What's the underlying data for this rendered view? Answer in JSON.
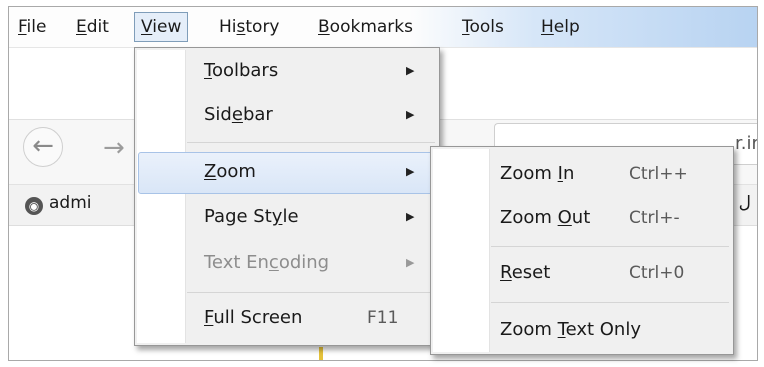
{
  "menubar": {
    "items": [
      {
        "pre": "",
        "acc": "F",
        "post": "ile"
      },
      {
        "pre": "",
        "acc": "E",
        "post": "dit"
      },
      {
        "pre": "",
        "acc": "V",
        "post": "iew"
      },
      {
        "pre": "Hi",
        "acc": "s",
        "post": "tory"
      },
      {
        "pre": "",
        "acc": "B",
        "post": "ookmarks"
      },
      {
        "pre": "",
        "acc": "T",
        "post": "ools"
      },
      {
        "pre": "",
        "acc": "H",
        "post": "elp"
      }
    ]
  },
  "browser": {
    "back_icon": "←",
    "forward_icon": "→",
    "url_fragment": "r.ir",
    "bookmark_label": "admi",
    "bookmark_icon": "globe-icon",
    "rtl_fragment": "ل"
  },
  "view_menu": {
    "items": [
      {
        "pre": "",
        "acc": "T",
        "post": "oolbars"
      },
      {
        "pre": "Sid",
        "acc": "e",
        "post": "bar"
      },
      {
        "pre": "",
        "acc": "Z",
        "post": "oom"
      },
      {
        "pre": "Page St",
        "acc": "y",
        "post": "le"
      },
      {
        "pre": "Text En",
        "acc": "c",
        "post": "oding"
      },
      {
        "pre": "",
        "acc": "F",
        "post": "ull Screen",
        "shortcut": "F11"
      }
    ],
    "submenu_arrow": "▶"
  },
  "zoom_menu": {
    "items": [
      {
        "pre": "Zoom ",
        "acc": "I",
        "post": "n",
        "shortcut": "Ctrl++"
      },
      {
        "pre": "Zoom ",
        "acc": "O",
        "post": "ut",
        "shortcut": "Ctrl+-"
      },
      {
        "pre": "",
        "acc": "R",
        "post": "eset",
        "shortcut": "Ctrl+0"
      },
      {
        "pre": "Zoom ",
        "acc": "T",
        "post": "ext Only"
      }
    ]
  },
  "colors": {
    "highlight": "#d9e6f7",
    "menu_bg": "#f0f0f0",
    "menubar_gradient_end": "#b6d2f1"
  }
}
